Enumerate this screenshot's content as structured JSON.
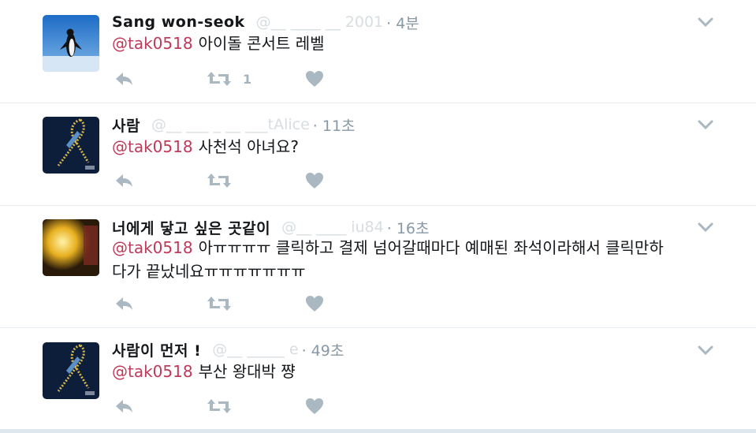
{
  "colors": {
    "mention": "#c0395a",
    "icon": "#aab8c2",
    "border": "#e6ecf0"
  },
  "tweets": [
    {
      "name": "Sang won-seok",
      "handle": "@__ ____ __ 2001",
      "time": "· 4분",
      "mention": "@tak0518",
      "text": "아이돌 콘서트 레벨",
      "text2": "",
      "retweet_count": "1",
      "avatar": "penguin"
    },
    {
      "name": "사람 ",
      "handle": "@__ ___ _ __ ___tAlice",
      "time": "· 11초",
      "mention": "@tak0518",
      "text": "사천석 아녀요?",
      "text2": "",
      "retweet_count": "",
      "avatar": "ribbon"
    },
    {
      "name": "너에게 닿고 싶은 곳같이",
      "handle": "@__ ____ iu84",
      "time": "· 16초",
      "mention": "@tak0518",
      "text": "아ㅠㅠㅠㅠ 클릭하고 결제 넘어갈때마다 예매된 좌석이라해서 클릭만하",
      "text2": "다가 끝났네요ㅠㅠㅠㅠㅠㅠㅠ",
      "retweet_count": "",
      "avatar": "candle"
    },
    {
      "name": "사람이 먼저 !",
      "handle": "@__ _____ e",
      "time": "· 49초",
      "mention": "@tak0518",
      "text": "부산 왕대박 쨩",
      "text2": "",
      "retweet_count": "",
      "avatar": "ribbon"
    }
  ]
}
